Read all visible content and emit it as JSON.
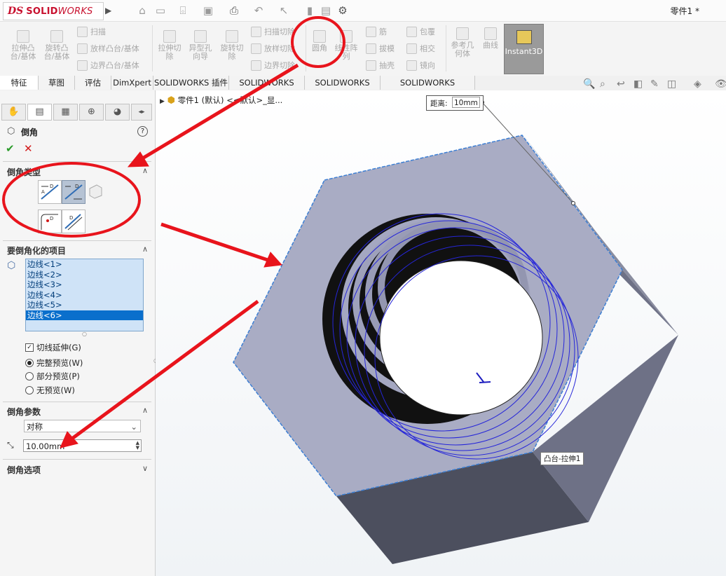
{
  "app": {
    "logo_ds": "DS",
    "logo_solid": "SOLID",
    "logo_works": "WORKS",
    "doc_title": "零件1 *"
  },
  "cmd": {
    "extrude_boss": "拉伸凸\n台/基体",
    "revolve_boss": "旋转凸\n台/基体",
    "sweep": "扫描",
    "loft": "放样凸台/基体",
    "boundary": "边界凸台/基体",
    "extrude_cut": "拉伸切\n除",
    "hole_wizard": "异型孔\n向导",
    "revolve_cut": "旋转切\n除",
    "sweep_cut": "扫描切除",
    "loft_cut": "放样切除",
    "boundary_cut": "边界切除",
    "fillet": "圆角",
    "linear_pattern": "线性阵\n列",
    "rib": "筋",
    "draft": "拔模",
    "shell": "抽壳",
    "wrap": "包覆",
    "intersect": "相交",
    "mirror": "镜向",
    "ref_geometry": "参考几\n何体",
    "curves": "曲线",
    "instant3d": "Instant3D"
  },
  "tabs": [
    "特征",
    "草图",
    "评估",
    "DimXpert",
    "SOLIDWORKS 插件",
    "SOLIDWORKS MBD",
    "SOLIDWORKS CAM",
    "SOLIDWORKS Inspection"
  ],
  "pm": {
    "title": "倒角",
    "help": "?",
    "ok": "✔",
    "cancel": "✕",
    "sec_type": "倒角类型",
    "sec_items": "要倒角化的项目",
    "edges": [
      "边线<1>",
      "边线<2>",
      "边线<3>",
      "边线<4>",
      "边线<5>",
      "边线<6>"
    ],
    "tangent": "切线延伸(G)",
    "preview_full": "完整预览(W)",
    "preview_partial": "部分预览(P)",
    "preview_none": "无预览(W)",
    "sec_params": "倒角参数",
    "symmetric": "对称",
    "distance": "10.00mm",
    "sec_options": "倒角选项"
  },
  "gfx": {
    "tree_label": "零件1  (默认) <<默认>_显...",
    "dist_label": "距离:",
    "dist_value": "10mm",
    "feature_tag": "凸台-拉伸1"
  },
  "colors": {
    "annotation_red": "#e8141c",
    "brand_red": "#c8102e",
    "selection_blue": "#0a6fcc",
    "nut_face": "#a9acc4",
    "thread_blue": "#2626d9"
  }
}
